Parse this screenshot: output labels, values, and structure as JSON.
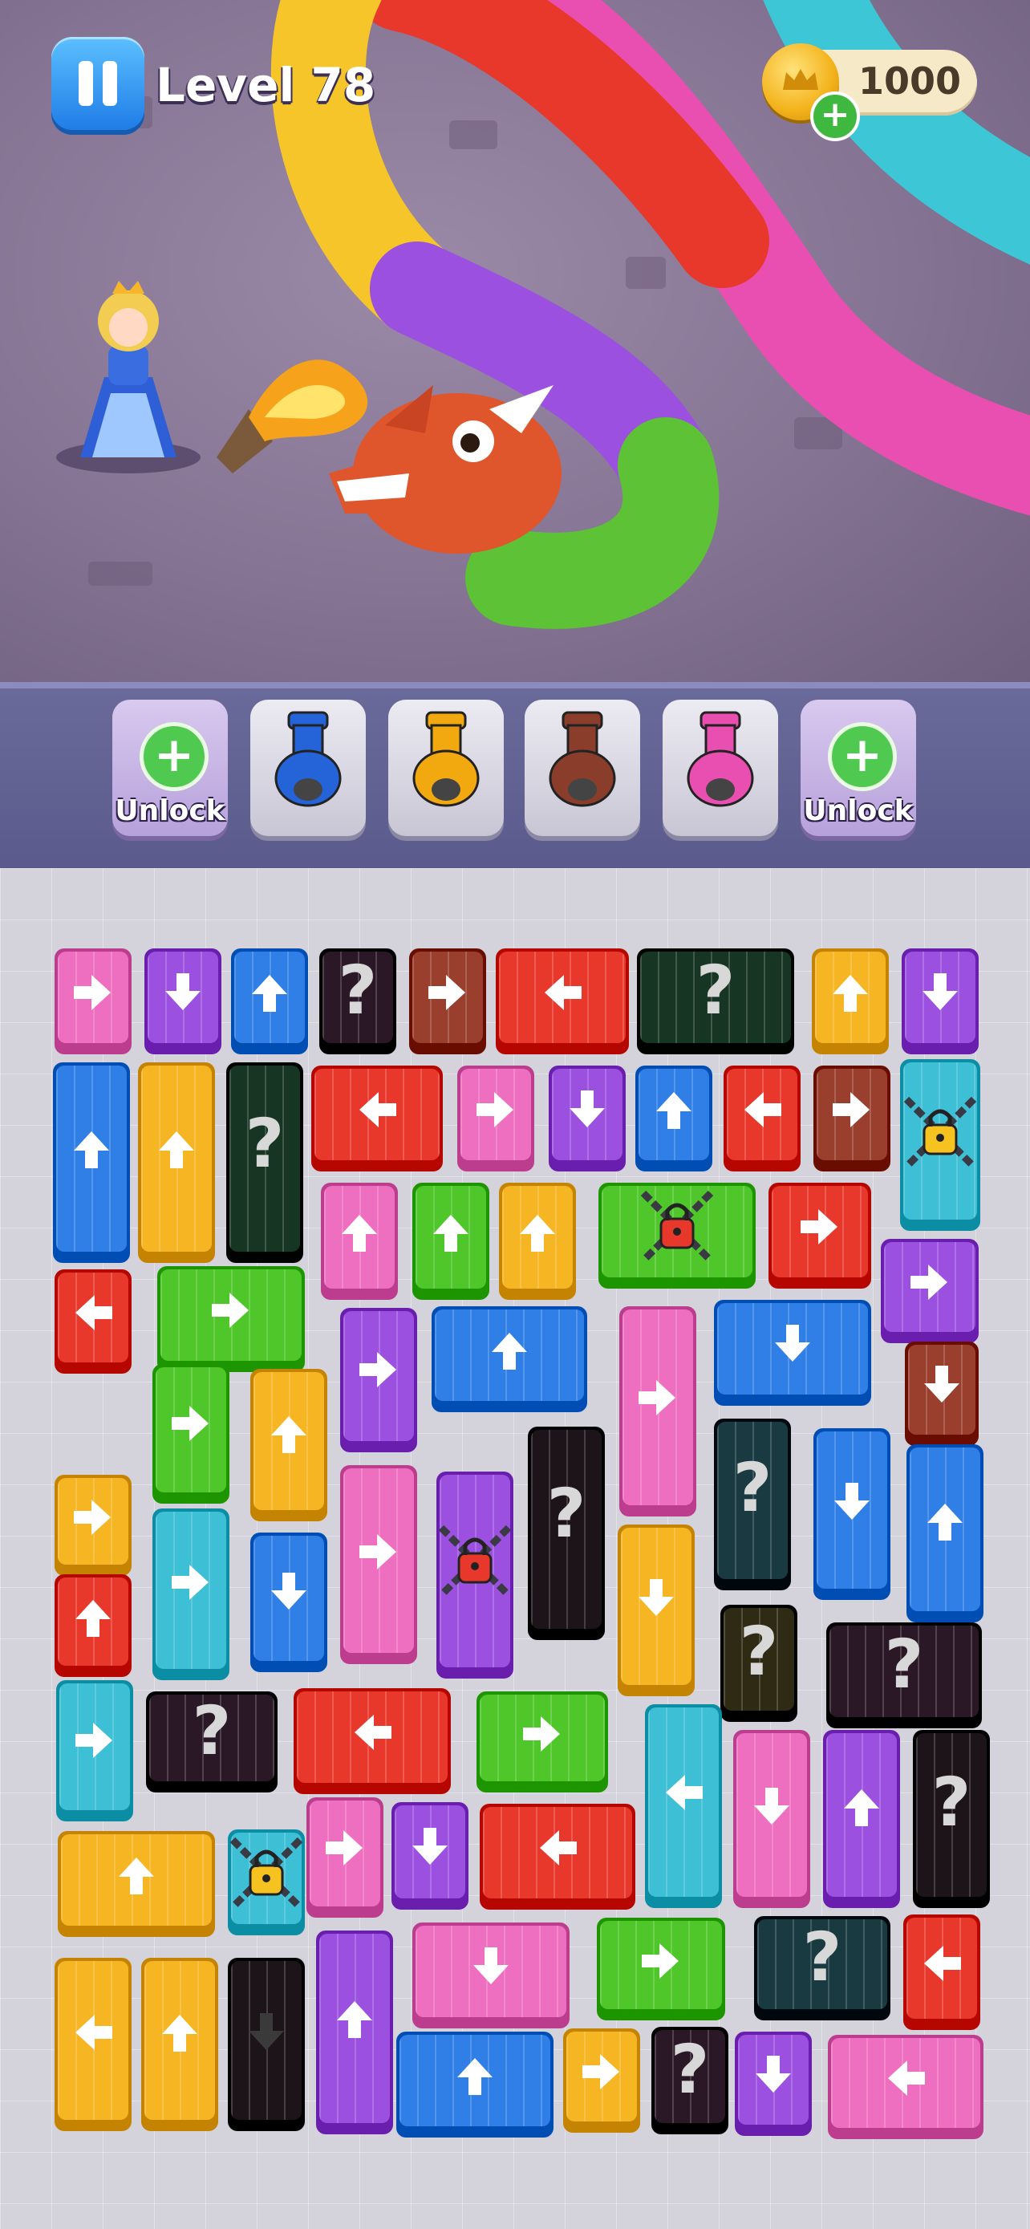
{
  "hud": {
    "level_label": "Level 78",
    "coins": "1000",
    "pause_icon": "pause-icon",
    "coin_icon": "crown-coin-icon",
    "add_icon": "plus-icon"
  },
  "scene": {
    "princess": "princess-character",
    "dragon": "dragon-head",
    "torch": "flame-torch"
  },
  "tray": {
    "slots": [
      {
        "kind": "locked",
        "label": "Unlock"
      },
      {
        "kind": "cannon",
        "color": "#2563d8"
      },
      {
        "kind": "cannon",
        "color": "#f2a90f"
      },
      {
        "kind": "cannon",
        "color": "#8a3d2a"
      },
      {
        "kind": "cannon",
        "color": "#e94fb0"
      },
      {
        "kind": "locked",
        "label": "Unlock"
      }
    ]
  },
  "colors": {
    "pink": "#ee6fc0",
    "purple": "#9b50e0",
    "blue": "#2f7fe6",
    "red": "#e8382c",
    "yellow": "#f6b523",
    "green": "#4fc72a",
    "teal": "#3dbfd6",
    "brown": "#9a3f2d",
    "dark": "#2a1826",
    "darkgreen": "#173523",
    "darkteal": "#183a40",
    "darkolive": "#2f2a14",
    "black": "#1c1418"
  },
  "blocks": [
    {
      "c": "pink",
      "a": "right"
    },
    {
      "c": "purple",
      "a": "down"
    },
    {
      "c": "blue",
      "a": "up"
    },
    {
      "c": "dark",
      "a": "?"
    },
    {
      "c": "brown",
      "a": "right"
    },
    {
      "c": "red",
      "a": "left"
    },
    {
      "c": "darkgreen",
      "a": "?"
    },
    {
      "c": "yellow",
      "a": "up"
    },
    {
      "c": "purple",
      "a": "down"
    },
    {
      "c": "blue",
      "a": "up"
    },
    {
      "c": "yellow",
      "a": "up"
    },
    {
      "c": "darkgreen",
      "a": "?"
    },
    {
      "c": "red",
      "a": "left"
    },
    {
      "c": "pink",
      "a": "right"
    },
    {
      "c": "purple",
      "a": "down"
    },
    {
      "c": "blue",
      "a": "up"
    },
    {
      "c": "red",
      "a": "left"
    },
    {
      "c": "brown",
      "a": "right"
    },
    {
      "c": "teal",
      "a": "lock"
    },
    {
      "c": "pink",
      "a": "up"
    },
    {
      "c": "green",
      "a": "up"
    },
    {
      "c": "yellow",
      "a": "up"
    },
    {
      "c": "green",
      "a": "lock"
    },
    {
      "c": "red",
      "a": "right"
    },
    {
      "c": "red",
      "a": "left"
    },
    {
      "c": "purple",
      "a": "right"
    },
    {
      "c": "purple",
      "a": "right"
    },
    {
      "c": "blue",
      "a": "up"
    },
    {
      "c": "pink",
      "a": "right"
    },
    {
      "c": "blue",
      "a": "down"
    },
    {
      "c": "green",
      "a": "right"
    },
    {
      "c": "green",
      "a": "right"
    },
    {
      "c": "yellow",
      "a": "up"
    },
    {
      "c": "brown",
      "a": "down"
    },
    {
      "c": "yellow",
      "a": "right"
    },
    {
      "c": "pink",
      "a": "right"
    },
    {
      "c": "purple",
      "a": "lock"
    },
    {
      "c": "black",
      "a": "?"
    },
    {
      "c": "darkteal",
      "a": "?"
    },
    {
      "c": "blue",
      "a": "down"
    },
    {
      "c": "blue",
      "a": "up"
    },
    {
      "c": "dark",
      "a": "?"
    },
    {
      "c": "teal",
      "a": "right"
    },
    {
      "c": "blue",
      "a": "down"
    },
    {
      "c": "yellow",
      "a": "down"
    },
    {
      "c": "darkolive",
      "a": "?"
    },
    {
      "c": "red",
      "a": "up"
    },
    {
      "c": "teal",
      "a": "right"
    },
    {
      "c": "dark",
      "a": "?"
    },
    {
      "c": "red",
      "a": "left"
    },
    {
      "c": "green",
      "a": "right"
    },
    {
      "c": "teal",
      "a": "left"
    },
    {
      "c": "pink",
      "a": "down"
    },
    {
      "c": "purple",
      "a": "up"
    },
    {
      "c": "black",
      "a": "?"
    },
    {
      "c": "yellow",
      "a": "up"
    },
    {
      "c": "teal",
      "a": "lock"
    },
    {
      "c": "pink",
      "a": "right"
    },
    {
      "c": "purple",
      "a": "down"
    },
    {
      "c": "red",
      "a": "left"
    },
    {
      "c": "yellow",
      "a": "left"
    },
    {
      "c": "yellow",
      "a": "up"
    },
    {
      "c": "black",
      "a": "down"
    },
    {
      "c": "purple",
      "a": "up"
    },
    {
      "c": "pink",
      "a": "down"
    },
    {
      "c": "green",
      "a": "right"
    },
    {
      "c": "darkteal",
      "a": "?"
    },
    {
      "c": "red",
      "a": "left"
    },
    {
      "c": "blue",
      "a": "up"
    },
    {
      "c": "yellow",
      "a": "right"
    },
    {
      "c": "dark",
      "a": "?"
    },
    {
      "c": "purple",
      "a": "down"
    },
    {
      "c": "pink",
      "a": "left"
    },
    {
      "c": "teal",
      "a": "lock"
    }
  ]
}
